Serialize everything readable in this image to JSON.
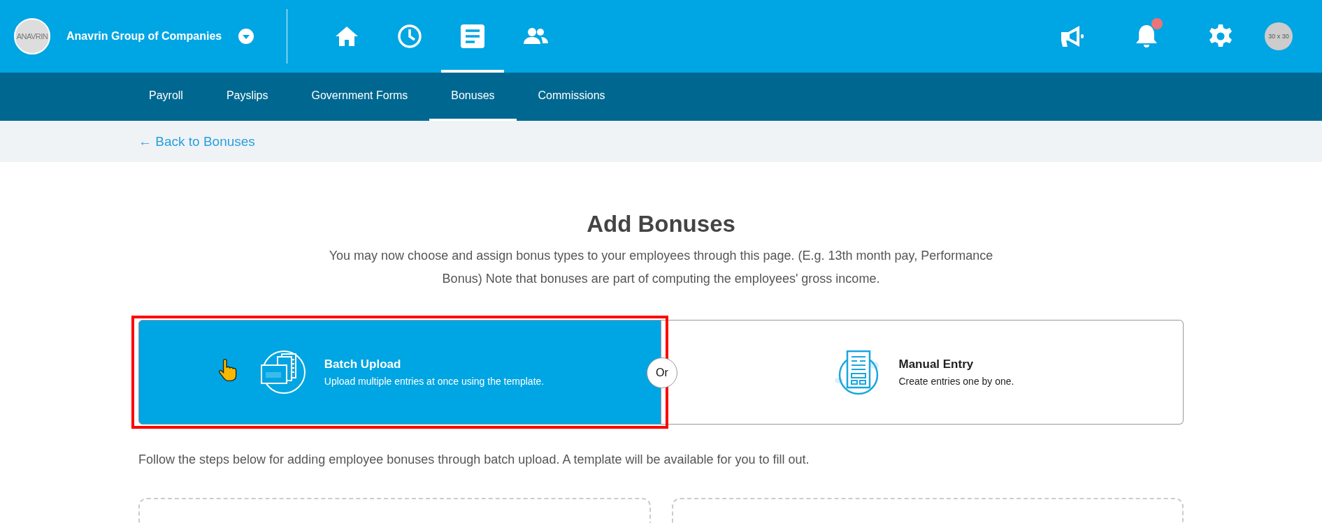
{
  "topbar": {
    "logo_text": "ANAVRIN",
    "company": "Anavrin Group of Companies",
    "nav_icons": [
      {
        "kind": "home",
        "selected": false
      },
      {
        "kind": "clock",
        "selected": false
      },
      {
        "kind": "document",
        "selected": true
      },
      {
        "kind": "people",
        "selected": false
      }
    ],
    "actions": [
      {
        "kind": "megaphone",
        "notification": false
      },
      {
        "kind": "bell",
        "notification": true
      },
      {
        "kind": "gear",
        "notification": false
      }
    ],
    "avatar": "30 x 30"
  },
  "subnav": [
    {
      "label": "Payroll",
      "selected": false
    },
    {
      "label": "Payslips",
      "selected": false
    },
    {
      "label": "Government Forms",
      "selected": false
    },
    {
      "label": "Bonuses",
      "selected": true
    },
    {
      "label": "Commissions",
      "selected": false
    }
  ],
  "back_link": "← Back to Bonuses",
  "title": "Add Bonuses",
  "description": "You may now choose and assign bonus types to your employees through this page. (E.g. 13th month pay, Performance Bonus) Note that bonuses are part of computing the employees' gross income.",
  "options": [
    {
      "kind": "batch",
      "title": "Batch Upload",
      "subtitle": "Upload multiple entries at once using the template.",
      "selected": true
    },
    {
      "kind": "manual",
      "title": "Manual Entry",
      "subtitle": "Create entries one by one.",
      "selected": false
    }
  ],
  "separator": "Or",
  "highlight": true,
  "instructions": "Follow the steps below for adding employee bonuses through batch upload. A template will be available for you to fill out."
}
